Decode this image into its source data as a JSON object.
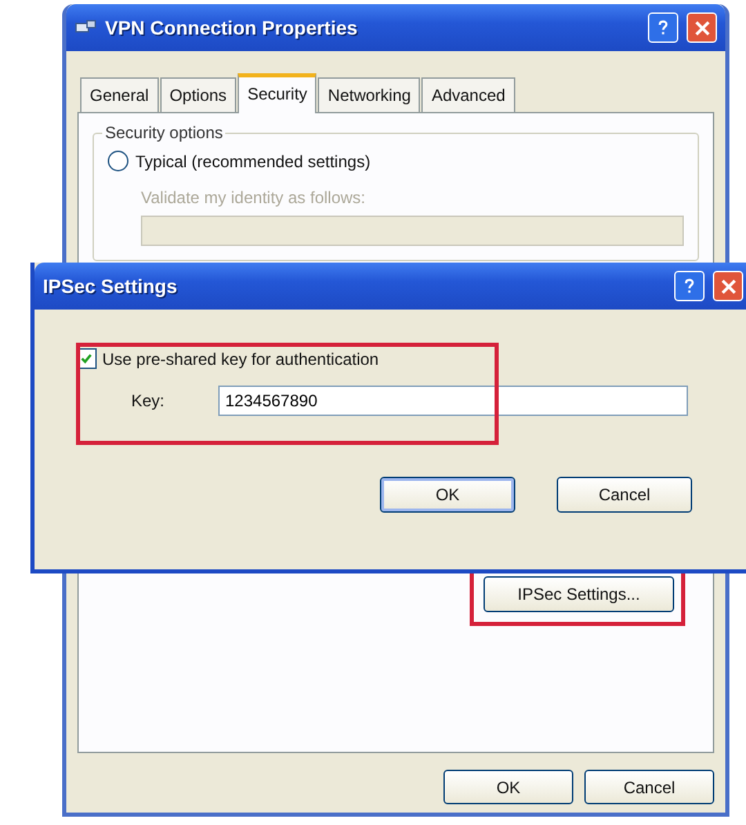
{
  "window": {
    "title": "VPN Connection Properties",
    "tabs": [
      {
        "label": "General",
        "selected": false
      },
      {
        "label": "Options",
        "selected": false
      },
      {
        "label": "Security",
        "selected": true
      },
      {
        "label": "Networking",
        "selected": false
      },
      {
        "label": "Advanced",
        "selected": false
      }
    ],
    "security_options": {
      "legend": "Security options",
      "radio": {
        "label": "Typical (recommended settings)",
        "selected": false
      },
      "validate": {
        "label": "Validate my identity as follows:",
        "disabled": true
      }
    },
    "ipsec_button": {
      "label": "IPSec Settings...",
      "highlighted": true
    },
    "buttons": [
      "OK",
      "Cancel"
    ]
  },
  "dialog": {
    "title": "IPSec Settings",
    "checkbox": {
      "label": "Use pre-shared key for authentication",
      "checked": true
    },
    "key": {
      "label": "Key:",
      "value": "1234567890"
    },
    "highlighted": true,
    "buttons": [
      "OK",
      "Cancel"
    ]
  }
}
